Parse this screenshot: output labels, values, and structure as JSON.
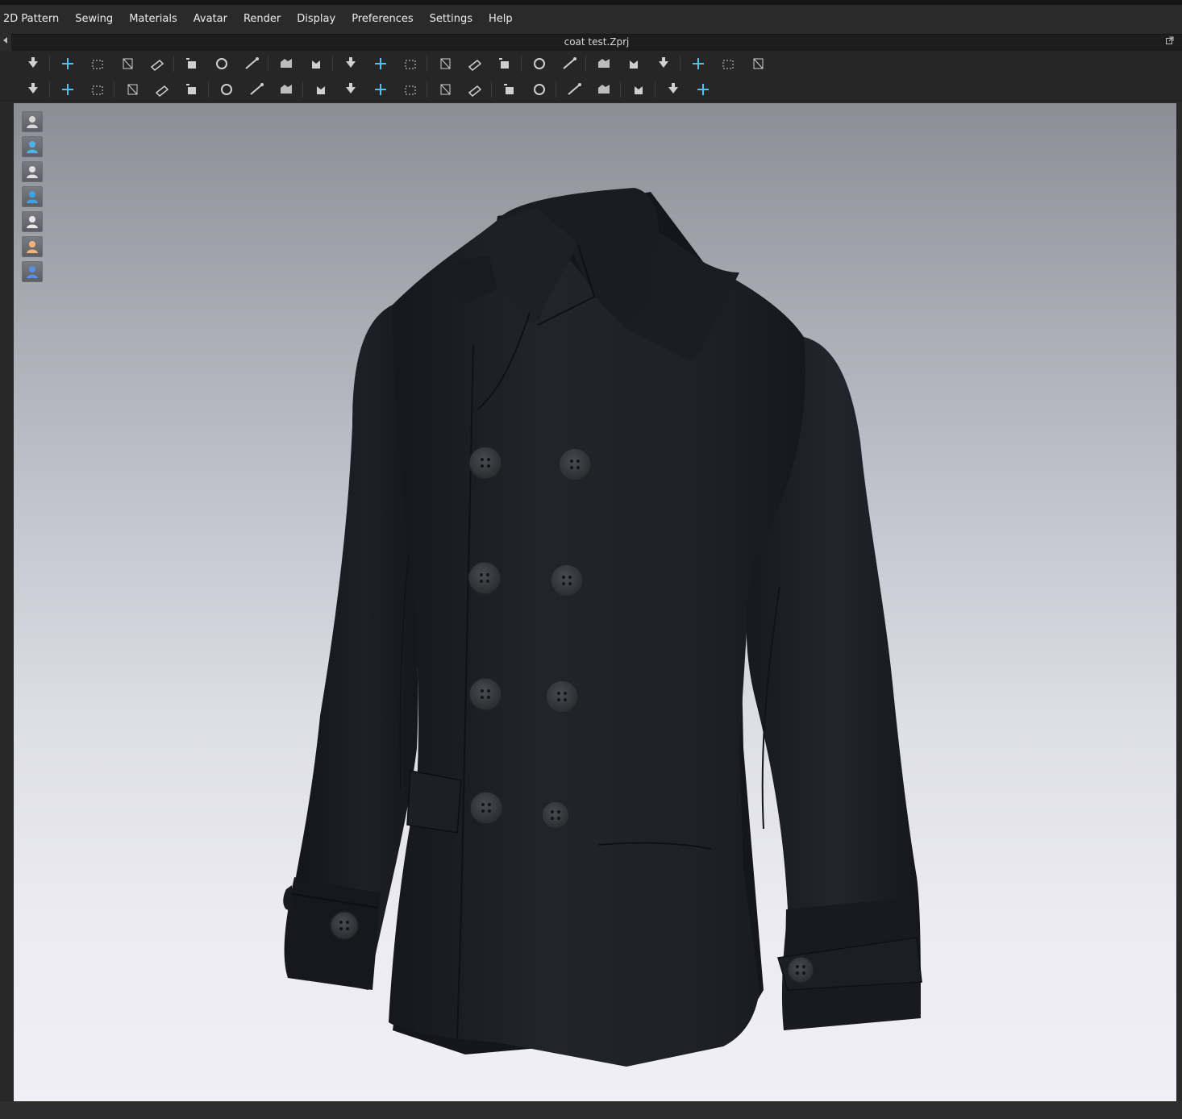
{
  "menubar": {
    "items": [
      "2D Pattern",
      "Sewing",
      "Materials",
      "Avatar",
      "Render",
      "Display",
      "Preferences",
      "Settings",
      "Help"
    ]
  },
  "window": {
    "title": "coat test.Zprj"
  },
  "toolbar_row1": [
    "drop-arrow-icon",
    "transform-move-icon",
    "select-box-icon",
    "edit-pattern-icon",
    "pin-icon",
    "fold-arrange-icon",
    "fold-lock-icon",
    "fold-rotate-icon",
    "line-tool-icon",
    "brush-icon",
    "garment-hanger-icon",
    "tshirt-solid-icon",
    "shirt-outline-icon",
    "avatar-shirt-icon",
    "arrangement-up-icon",
    "arrangement-down-icon",
    "arrangement-avatar-icon",
    "layers-stack-icon",
    "layers-down-icon",
    "vertical-pin-icon",
    "split-body-icon",
    "curve-measure-icon",
    "tape-measure-icon",
    "ruler-icon"
  ],
  "toolbar_row2": [
    "avatar-walk-icon",
    "needle-icon",
    "sewing-needle-icon",
    "x-pin-icon",
    "scissors-icon",
    "trace-shirt-icon",
    "graphic-stamp-icon",
    "topstitch-icon",
    "fabric-stamp-icon",
    "button-icon",
    "buttonhole-icon",
    "line-measure-icon",
    "lock-button-icon",
    "zipper-icon",
    "puckering-icon",
    "fill-puckering-icon",
    "shirring-icon",
    "fill-shirring-icon",
    "gather-icon",
    "tuck-icon",
    "shirt-fit-icon",
    "globe-shirt-icon"
  ],
  "side_toolbar": [
    "garment-view-icon",
    "garment-texture-icon",
    "avatar-view-icon",
    "fabric-render-icon",
    "flat-shading-icon",
    "avatar-skin-icon",
    "mesh-globe-icon"
  ],
  "colors": {
    "fabric": "#1d1f26",
    "button": "#3a3b40",
    "viewport_top": "#8c8d95",
    "viewport_bottom": "#efeff5"
  }
}
